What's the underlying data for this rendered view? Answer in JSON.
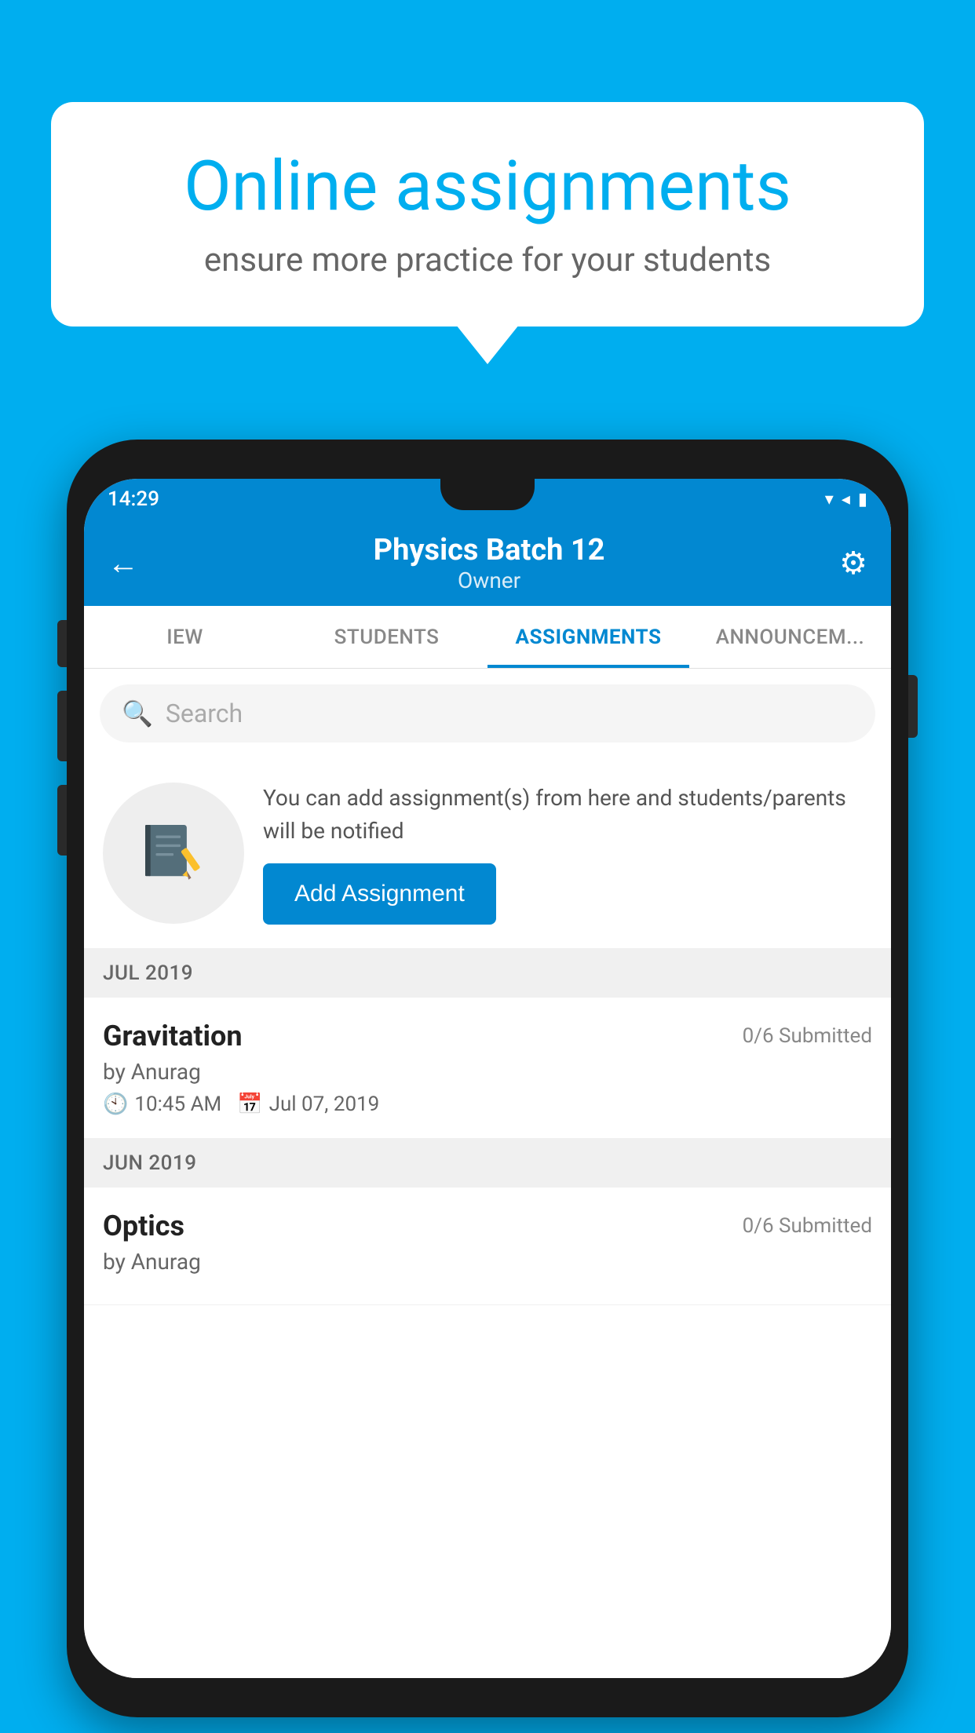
{
  "background_color": "#00AEEF",
  "speech_bubble": {
    "title": "Online assignments",
    "subtitle": "ensure more practice for your students"
  },
  "status_bar": {
    "time": "14:29",
    "icons": "▾◂▮"
  },
  "header": {
    "back_label": "←",
    "batch_name": "Physics Batch 12",
    "batch_role": "Owner",
    "settings_label": "⚙"
  },
  "tabs": [
    {
      "label": "IEW",
      "active": false
    },
    {
      "label": "STUDENTS",
      "active": false
    },
    {
      "label": "ASSIGNMENTS",
      "active": true
    },
    {
      "label": "ANNOUNCEM...",
      "active": false
    }
  ],
  "search": {
    "placeholder": "Search"
  },
  "add_assignment": {
    "description": "You can add assignment(s) from here and students/parents will be notified",
    "button_label": "Add Assignment"
  },
  "sections": [
    {
      "header": "JUL 2019",
      "items": [
        {
          "title": "Gravitation",
          "submitted": "0/6 Submitted",
          "author": "by Anurag",
          "time": "10:45 AM",
          "date": "Jul 07, 2019"
        }
      ]
    },
    {
      "header": "JUN 2019",
      "items": [
        {
          "title": "Optics",
          "submitted": "0/6 Submitted",
          "author": "by Anurag",
          "time": "",
          "date": ""
        }
      ]
    }
  ]
}
